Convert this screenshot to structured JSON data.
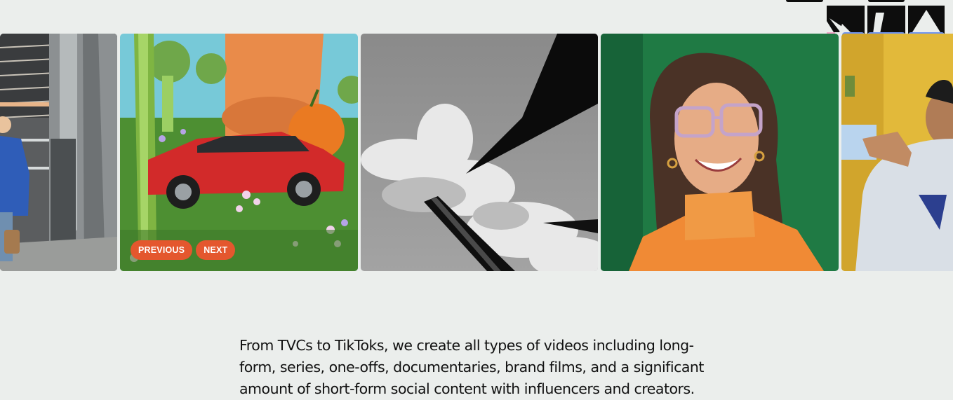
{
  "carousel": {
    "previous_label": "PREVIOUS",
    "next_label": "NEXT"
  },
  "intro": {
    "text": "From TVCs to TikToks, we create all types of videos including long-form, series, one-offs, documentaries, brand films, and a significant amount of short-form social content with influencers and creators."
  },
  "colors": {
    "page_background": "#ebeeec",
    "button_background": "#e4572e",
    "button_text": "#ffffff",
    "logo_accent_blue": "#6f94f0",
    "logo_accent_pink": "#f2a6c8"
  }
}
